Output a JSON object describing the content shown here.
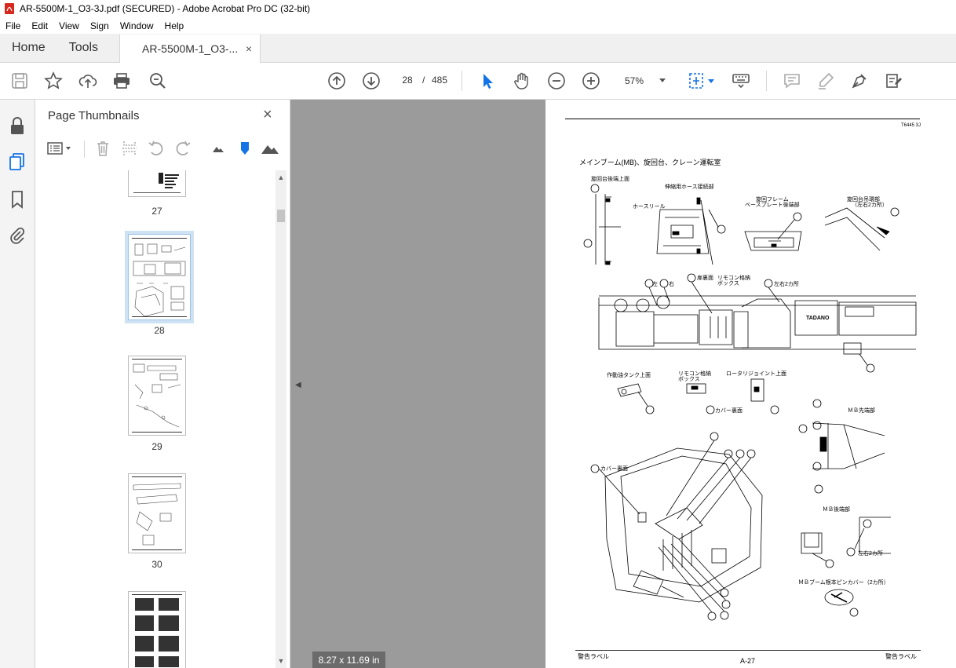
{
  "window": {
    "title": "AR-5500M-1_O3-3J.pdf (SECURED) - Adobe Acrobat Pro DC (32-bit)"
  },
  "menu": [
    "File",
    "Edit",
    "View",
    "Sign",
    "Window",
    "Help"
  ],
  "tabs": {
    "home": "Home",
    "tools": "Tools",
    "document": "AR-5500M-1_O3-...",
    "close": "×"
  },
  "toolbar": {
    "page_current": "28",
    "page_sep": "/",
    "page_total": "485",
    "zoom": "57%"
  },
  "thumbnails": {
    "title": "Page Thumbnails",
    "close": "×",
    "pages": [
      {
        "label": "27"
      },
      {
        "label": "28",
        "selected": true
      },
      {
        "label": "29"
      },
      {
        "label": "30"
      }
    ]
  },
  "status": {
    "page_size": "8.27 x 11.69 in"
  },
  "document_page": {
    "code": "T6445 3J",
    "heading": "メインブーム(MB)、旋回台、クレーン運転室",
    "labels": {
      "l1": "旋回台後端上面",
      "l2": "伸縮用ホース接続部",
      "l3": "ホースリール",
      "l4": "旋回フレーム",
      "l5": "ベースプレート後端部",
      "l6": "旋回台吊環部",
      "l7": "（左右2カ所）",
      "l8": "左",
      "l9": "右",
      "l10": "扉裏面",
      "l11": "リモコン格納",
      "l12": "ボックス",
      "l13": "左右2カ所",
      "l14": "作動油タンク上面",
      "l15": "リモコン格納",
      "l16": "ボックス",
      "l17": "ロータリジョイント上面",
      "l18": "カバー裏面",
      "l19": "ＭＢ先端部",
      "l20": "カバー裏面",
      "l21": "ＭＢ後端部",
      "l22": "左右2カ所",
      "l23": "ＭＢブーム根本ピンカバー（2カ所）",
      "l24": "TADANO"
    },
    "footer_left": "警告ラベル",
    "footer_center": "A-27",
    "footer_right": "警告ラベル"
  }
}
